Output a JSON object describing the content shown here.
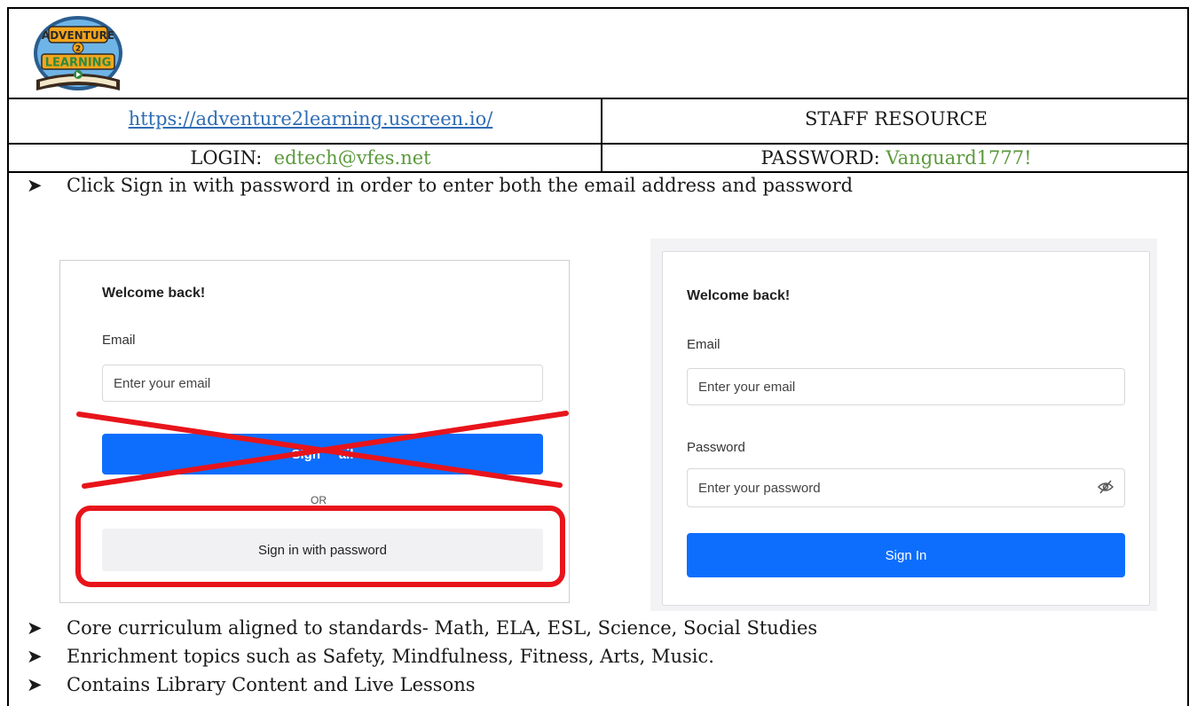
{
  "header": {
    "logo_alt": "Adventure 2 Learning",
    "url": "https://adventure2learning.uscreen.io/",
    "resource_label": "STAFF RESOURCE",
    "login_label": "LOGIN:",
    "login_value": "edtech@vfes.net",
    "password_label": "PASSWORD:",
    "password_value": "Vanguard1777!"
  },
  "bullets": [
    "Click Sign in with password in order to enter both the email address and password",
    "Core curriculum aligned to standards- Math, ELA, ESL, Science, Social Studies",
    "Enrichment topics such as Safety, Mindfulness, Fitness, Arts, Music.",
    "Contains Library Content and Live Lessons"
  ],
  "left_panel": {
    "title": "Welcome back!",
    "email_label": "Email",
    "email_placeholder": "Enter your email",
    "email_button": "Sign in with email",
    "email_button_visible": "Sign     ail",
    "or": "OR",
    "password_button": "Sign in with password"
  },
  "right_panel": {
    "title": "Welcome back!",
    "email_label": "Email",
    "email_placeholder": "Enter your email",
    "password_label": "Password",
    "password_placeholder": "Enter your password",
    "sign_in_button": "Sign In"
  },
  "colors": {
    "link": "#2f6db4",
    "credential_green": "#5b9a3c",
    "button_blue": "#0d6efd",
    "annotation_red": "#e8141b"
  }
}
